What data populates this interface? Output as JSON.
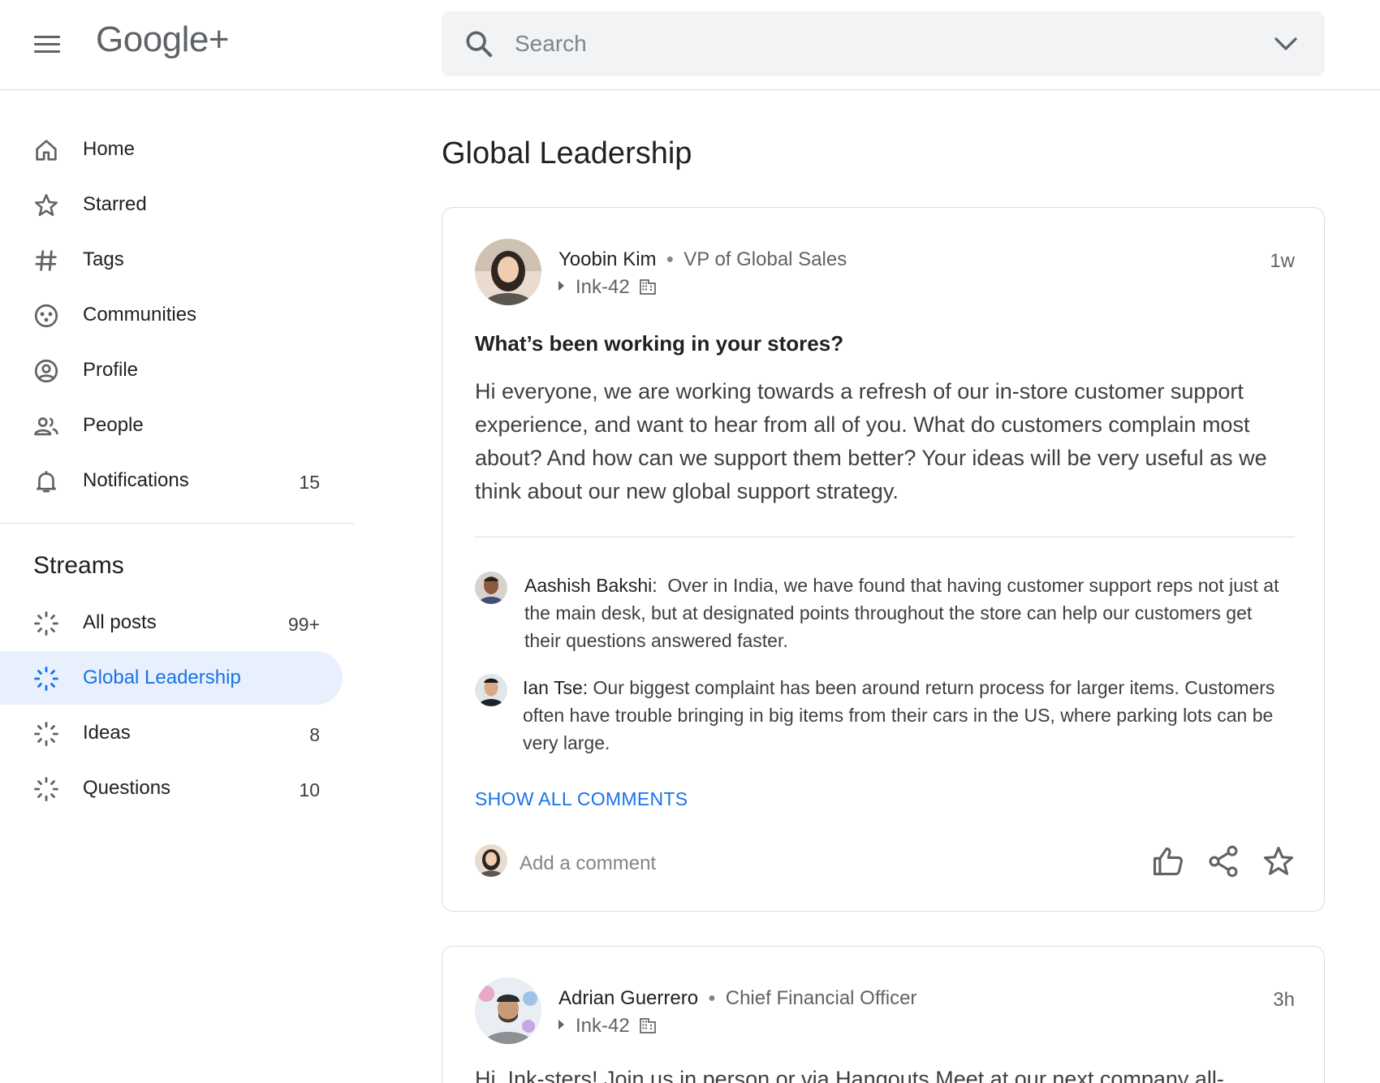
{
  "header": {
    "logo_text": "Google+",
    "search_placeholder": "Search"
  },
  "sidebar": {
    "nav": [
      {
        "label": "Home",
        "icon": "home-icon",
        "count": ""
      },
      {
        "label": "Starred",
        "icon": "star-icon",
        "count": ""
      },
      {
        "label": "Tags",
        "icon": "hashtag-icon",
        "count": ""
      },
      {
        "label": "Communities",
        "icon": "communities-icon",
        "count": ""
      },
      {
        "label": "Profile",
        "icon": "profile-icon",
        "count": ""
      },
      {
        "label": "People",
        "icon": "people-icon",
        "count": ""
      },
      {
        "label": "Notifications",
        "icon": "bell-icon",
        "count": "15"
      }
    ],
    "streams_title": "Streams",
    "streams": [
      {
        "label": "All posts",
        "icon": "stream-icon",
        "count": "99+"
      },
      {
        "label": "Global Leadership",
        "icon": "stream-icon",
        "count": "",
        "active": true
      },
      {
        "label": "Ideas",
        "icon": "stream-icon",
        "count": "8"
      },
      {
        "label": "Questions",
        "icon": "stream-icon",
        "count": "10"
      }
    ]
  },
  "main": {
    "title": "Global Leadership",
    "posts": [
      {
        "author": "Yoobin Kim",
        "role": "VP of Global Sales",
        "org": "Ink-42",
        "time": "1w",
        "title": "What’s been working in your stores?",
        "body": "Hi everyone, we are working towards a refresh of our in-store customer support experience, and want to hear from all of you. What do customers complain most about? And how can we support them better? Your ideas will be very useful as we think about our new global support strategy.",
        "comments": [
          {
            "name": "Aashish Bakshi:",
            "text": "Over in India, we have found that having customer support reps not just at the main desk, but at designated points throughout the store can help our customers get their questions answered faster."
          },
          {
            "name": "Ian Tse:",
            "text": "Our biggest complaint has been around return process for larger items. Customers often have trouble bringing in big items from their cars in the US, where parking lots can be very large."
          }
        ],
        "show_all": "SHOW ALL COMMENTS",
        "add_comment_placeholder": "Add a comment"
      },
      {
        "author": "Adrian Guerrero",
        "role": "Chief Financial Officer",
        "org": "Ink-42",
        "time": "3h",
        "snippet": "Hi, Ink-sters! Join us in person or via Hangouts Meet at our next company all-"
      }
    ]
  },
  "colors": {
    "accent": "#1a73e8",
    "active_bg": "#e8f0fe",
    "search_bg": "#f1f3f4",
    "divider": "#dadce0"
  }
}
